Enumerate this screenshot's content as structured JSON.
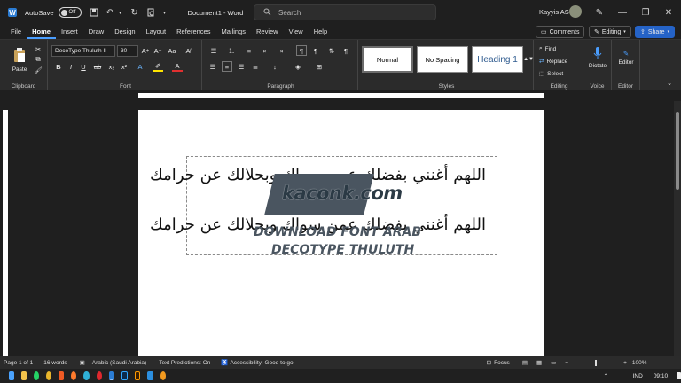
{
  "titlebar": {
    "autosave_label": "AutoSave",
    "autosave_state": "Off",
    "doc_title": "Document1  -  Word",
    "search_placeholder": "Search",
    "user_name": "Kayyis AS"
  },
  "menu": [
    "File",
    "Home",
    "Insert",
    "Draw",
    "Design",
    "Layout",
    "References",
    "Mailings",
    "Review",
    "View",
    "Help"
  ],
  "menu_active": "Home",
  "right_actions": {
    "comments": "Comments",
    "editing": "Editing",
    "share": "Share"
  },
  "ribbon": {
    "clipboard": {
      "paste": "Paste",
      "label": "Clipboard"
    },
    "font": {
      "name": "DecoType Thuluth II",
      "size": "30",
      "label": "Font"
    },
    "paragraph": {
      "label": "Paragraph"
    },
    "styles": {
      "items": [
        "Normal",
        "No Spacing",
        "Heading 1"
      ],
      "label": "Styles"
    },
    "editing": {
      "find": "Find",
      "replace": "Replace",
      "select": "Select",
      "label": "Editing"
    },
    "voice": {
      "dictate": "Dictate",
      "label": "Voice"
    },
    "editor": {
      "editor": "Editor",
      "label": "Editor"
    }
  },
  "document": {
    "line1": "اللهم أغنني بفضلك عمن سواك وبحلالك عن حرامك",
    "line2": "اللهم أغنني بفضلك عمن سواك وبحلالك عن حرامك"
  },
  "watermark": {
    "brand": "kaconk.com",
    "line1": "DOWNLOAD FONT ARAB",
    "line2": "DECOTYPE THULUTH"
  },
  "status": {
    "page": "Page 1 of 1",
    "words": "16 words",
    "language": "Arabic (Saudi Arabia)",
    "predictions": "Text Predictions: On",
    "accessibility": "Accessibility: Good to go",
    "focus": "Focus",
    "zoom": "100%"
  },
  "taskbar": {
    "lang": "IND",
    "time": "09:10"
  },
  "colors": {
    "accent": "#4a9eff",
    "share_bg": "#2563c7",
    "watermark_dark": "#4a5560",
    "watermark_light": "#2b3a45"
  }
}
